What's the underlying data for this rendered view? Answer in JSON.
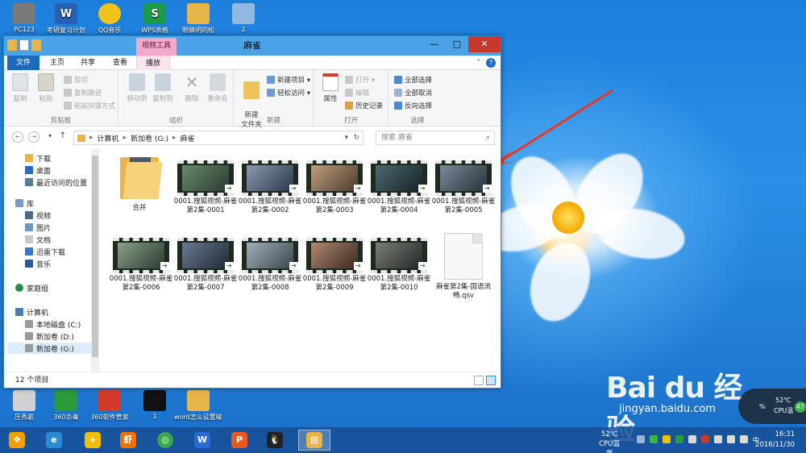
{
  "desktop": {
    "icons_top": [
      {
        "label": "PC123",
        "color": "#7a7a7a"
      },
      {
        "label": "考研复习计划",
        "color": "#2b5fb5"
      },
      {
        "label": "QQ音乐",
        "color": "#f0c21a"
      },
      {
        "label": "WPS表格",
        "color": "#1a9a4a"
      },
      {
        "label": "眼睛明的松",
        "color": "#e8b548"
      },
      {
        "label": "2",
        "color": "#8fb9e0"
      }
    ],
    "icons_bottom": [
      {
        "label": "压秀歌",
        "color": "#d0d0d0"
      },
      {
        "label": "360杀毒",
        "color": "#2a9a3a"
      },
      {
        "label": "360软件管家",
        "color": "#d33a2a"
      },
      {
        "label": "1",
        "color": "#111111"
      },
      {
        "label": "word怎么设置输注",
        "color": "#e8b548"
      }
    ]
  },
  "window": {
    "title": "麻雀",
    "context_tab_header": "视频工具",
    "controls": {
      "minimize": "—",
      "maximize": "□",
      "close": "✕"
    },
    "tabs": [
      "文件",
      "主页",
      "共享",
      "查看",
      "播放"
    ],
    "help_icon": "?",
    "ribbon_min_icon": "⌃"
  },
  "ribbon": {
    "clipboard": {
      "name": "剪贴板",
      "copy": "复制",
      "paste": "粘贴",
      "cut": "剪切",
      "copy_path": "复制路径",
      "paste_shortcut": "粘贴快捷方式"
    },
    "organize": {
      "name": "组织",
      "move_to": "移动到",
      "copy_to": "复制到",
      "delete": "删除",
      "rename": "重命名"
    },
    "new": {
      "name": "新建",
      "new_folder": "新建\n文件夹",
      "new_item": "新建项目 ▾",
      "easy_access": "轻松访问 ▾"
    },
    "open": {
      "name": "打开",
      "properties": "属性",
      "open": "打开 ▾",
      "edit": "编辑",
      "history": "历史记录"
    },
    "select": {
      "name": "选择",
      "select_all": "全部选择",
      "select_none": "全部取消",
      "invert": "反向选择"
    }
  },
  "address": {
    "back": "←",
    "forward": "→",
    "up": "↑",
    "path": [
      "计算机",
      "新加卷 (G:)",
      "麻雀"
    ],
    "dropdown": "▾",
    "refresh": "↻",
    "search_placeholder": "搜索 麻雀",
    "search_icon": "⌕"
  },
  "nav": {
    "favorites": [
      "下载",
      "桌面",
      "最近访问的位置"
    ],
    "library": "库",
    "library_items": [
      "视频",
      "图片",
      "文档",
      "迅雷下载",
      "音乐"
    ],
    "homegroup": "家庭组",
    "computer": "计算机",
    "drives": [
      "本地磁盘 (C:)",
      "新加卷 (D:)",
      "新加卷 (G:)"
    ]
  },
  "files": [
    {
      "name": "合并",
      "kind": "folder"
    },
    {
      "name": "0001.搜狐视频-麻雀第2集-0001",
      "kind": "video",
      "tint": "#3c4b42"
    },
    {
      "name": "0001.搜狐视频-麻雀第2集-0002",
      "kind": "video",
      "tint": "#4a5868"
    },
    {
      "name": "0001.搜狐视频-麻雀第2集-0003",
      "kind": "video",
      "tint": "#6b5a48"
    },
    {
      "name": "0001.搜狐视频-麻雀第2集-0004",
      "kind": "video",
      "tint": "#2e3a3c"
    },
    {
      "name": "0001.搜狐视频-麻雀第2集-0005",
      "kind": "video",
      "tint": "#3a4a55"
    },
    {
      "name": "0001.搜狐视频-麻雀第2集-0006",
      "kind": "video",
      "tint": "#4a5a50"
    },
    {
      "name": "0001.搜狐视频-麻雀第2集-0007",
      "kind": "video",
      "tint": "#3d4a5a"
    },
    {
      "name": "0001.搜狐视频-麻雀第2集-0008",
      "kind": "video",
      "tint": "#5a6a72"
    },
    {
      "name": "0001.搜狐视频-麻雀第2集-0009",
      "kind": "video",
      "tint": "#6a5040"
    },
    {
      "name": "0001.搜狐视频-麻雀第2集-0010",
      "kind": "video",
      "tint": "#3a4040"
    },
    {
      "name": "麻雀第2集-国语流畅.qsv",
      "kind": "document"
    }
  ],
  "status": {
    "count": "12 个项目"
  },
  "taskbar": {
    "apps": [
      {
        "name": "start",
        "color": "#f5a000",
        "glyph": "❖"
      },
      {
        "name": "browser",
        "color": "#2a8ad4",
        "glyph": "e"
      },
      {
        "name": "plus",
        "color": "#f0c000",
        "glyph": "+"
      },
      {
        "name": "xiami",
        "color": "#f07000",
        "glyph": "虾"
      },
      {
        "name": "360",
        "color": "#3aa84a",
        "glyph": "◎"
      },
      {
        "name": "wps-writer",
        "color": "#2a6ad4",
        "glyph": "W"
      },
      {
        "name": "wps-ppt",
        "color": "#e85a20",
        "glyph": "P"
      },
      {
        "name": "qq",
        "color": "#222222",
        "glyph": "🐧"
      },
      {
        "name": "explorer",
        "color": "#e8b548",
        "glyph": "▤"
      }
    ],
    "cpu_temp": "52℃",
    "cpu_label": "CPU温度",
    "time": "16:31",
    "date": "2016/11/30",
    "ime": "中"
  },
  "overlay": {
    "watermark_logo": "Bai du 经验",
    "watermark_url": "jingyan.baidu.com",
    "cpu_widget_temp": "52℃",
    "cpu_widget_label": "CPU温",
    "cpu_widget_percent": "%",
    "cpu_widget_side": "47"
  }
}
